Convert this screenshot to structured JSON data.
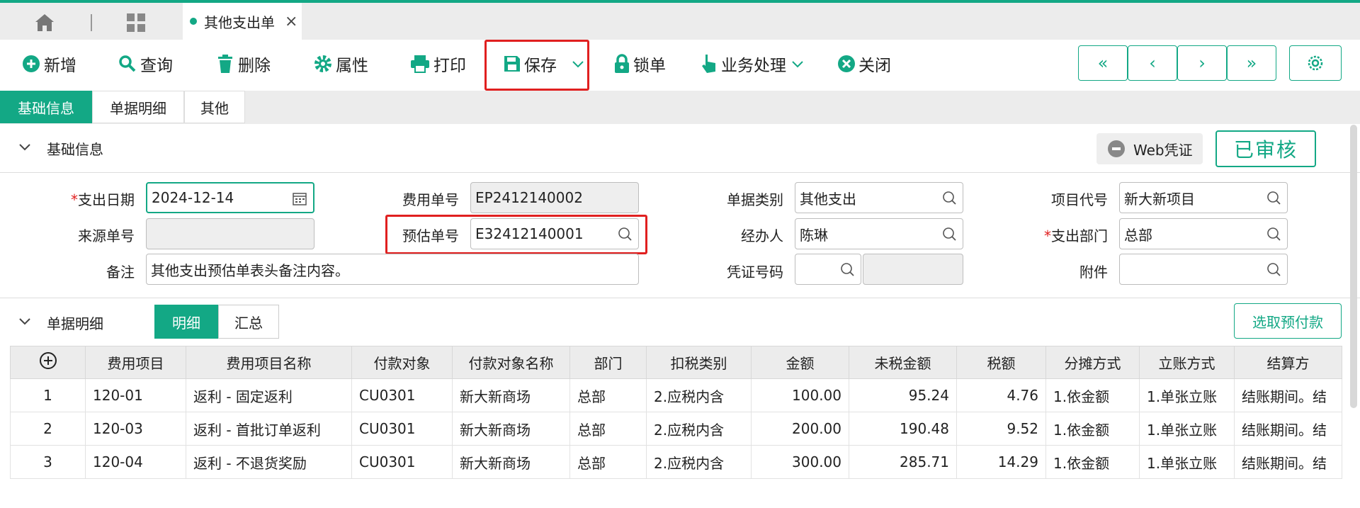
{
  "colors": {
    "accent": "#13a885",
    "highlight": "#e02020"
  },
  "top_tabs": {
    "active_tab": "其他支出单",
    "close_glyph": "×"
  },
  "toolbar": {
    "add": "新增",
    "query": "查询",
    "delete": "删除",
    "properties": "属性",
    "print": "打印",
    "save": "保存",
    "lock": "锁单",
    "business": "业务处理",
    "close": "关闭"
  },
  "nav": {
    "first": "«",
    "prev": "‹",
    "next": "›",
    "last": "»"
  },
  "section_tabs": [
    "基础信息",
    "单据明细",
    "其他"
  ],
  "basic": {
    "title": "基础信息",
    "web_voucher": "Web凭证",
    "status": "已审核"
  },
  "form": {
    "expense_date_label": "支出日期",
    "expense_date": "2024-12-14",
    "expense_no_label": "费用单号",
    "expense_no": "EP2412140002",
    "doc_type_label": "单据类别",
    "doc_type": "其他支出",
    "project_code_label": "项目代号",
    "project_code": "新大新项目",
    "source_no_label": "来源单号",
    "source_no": "",
    "estimate_no_label": "预估单号",
    "estimate_no": "E32412140001",
    "handler_label": "经办人",
    "handler": "陈琳",
    "dept_label": "支出部门",
    "dept": "总部",
    "remark_label": "备注",
    "remark": "其他支出预估单表头备注内容。",
    "voucher_no_label": "凭证号码",
    "voucher_no": "",
    "attachment_label": "附件",
    "attachment": "",
    "required_mark": "*"
  },
  "detail": {
    "title": "单据明细",
    "seg_detail": "明细",
    "seg_summary": "汇总",
    "pick_prepay": "选取预付款"
  },
  "table": {
    "headers": [
      "费用项目",
      "费用项目名称",
      "付款对象",
      "付款对象名称",
      "部门",
      "扣税类别",
      "金额",
      "未税金额",
      "税额",
      "分摊方式",
      "立账方式",
      "结算方"
    ],
    "rows": [
      {
        "n": "1",
        "item": "120-01",
        "item_name": "返利 - 固定返利",
        "payee": "CU0301",
        "payee_name": "新大新商场",
        "dept": "总部",
        "tax_type": "2.应税内含",
        "amount": "100.00",
        "pre_tax": "95.24",
        "tax": "4.76",
        "alloc": "1.依金额",
        "account": "1.单张立账",
        "settle": "结账期间。结"
      },
      {
        "n": "2",
        "item": "120-03",
        "item_name": "返利 - 首批订单返利",
        "payee": "CU0301",
        "payee_name": "新大新商场",
        "dept": "总部",
        "tax_type": "2.应税内含",
        "amount": "200.00",
        "pre_tax": "190.48",
        "tax": "9.52",
        "alloc": "1.依金额",
        "account": "1.单张立账",
        "settle": "结账期间。结"
      },
      {
        "n": "3",
        "item": "120-04",
        "item_name": "返利 - 不退货奖励",
        "payee": "CU0301",
        "payee_name": "新大新商场",
        "dept": "总部",
        "tax_type": "2.应税内含",
        "amount": "300.00",
        "pre_tax": "285.71",
        "tax": "14.29",
        "alloc": "1.依金额",
        "account": "1.单张立账",
        "settle": "结账期间。结"
      }
    ]
  }
}
